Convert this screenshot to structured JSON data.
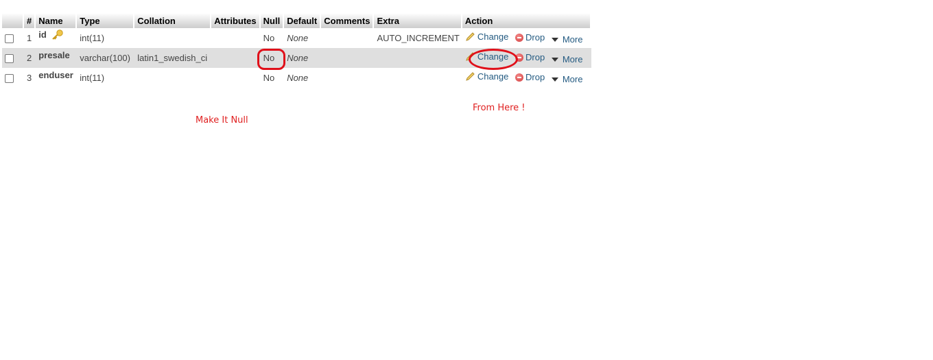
{
  "table": {
    "headers": [
      "",
      "#",
      "Name",
      "Type",
      "Collation",
      "Attributes",
      "Null",
      "Default",
      "Comments",
      "Extra",
      "Action"
    ],
    "rows": [
      {
        "num": "1",
        "name": "id",
        "primary_key_icon": "key-icon",
        "type": "int(11)",
        "collation": "",
        "attributes": "",
        "null": "No",
        "default": "None",
        "comments": "",
        "extra": "AUTO_INCREMENT"
      },
      {
        "num": "2",
        "name": "presale",
        "type": "varchar(100)",
        "collation": "latin1_swedish_ci",
        "attributes": "",
        "null": "No",
        "default": "None",
        "comments": "",
        "extra": ""
      },
      {
        "num": "3",
        "name": "enduser",
        "type": "int(11)",
        "collation": "",
        "attributes": "",
        "null": "No",
        "default": "None",
        "comments": "",
        "extra": ""
      }
    ],
    "actions": {
      "change": "Change",
      "drop": "Drop",
      "more": "More"
    }
  },
  "annotations": {
    "make_null": "Make It Null",
    "from_here": "From Here !",
    "color": "#e02020"
  }
}
